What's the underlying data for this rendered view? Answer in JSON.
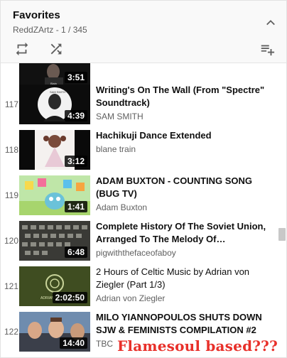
{
  "playlist": {
    "title": "Favorites",
    "owner": "ReddZArtz",
    "separator": " - ",
    "position": "1 / 345"
  },
  "icons": {
    "collapse": "chevron-up-icon",
    "loop": "repeat-icon",
    "shuffle": "shuffle-icon",
    "save": "playlist-add-icon"
  },
  "items": [
    {
      "index": "",
      "title": "",
      "channel": "",
      "duration": "3:51"
    },
    {
      "index": "117",
      "title": "Writing's On The Wall (From \"Spectre\" Soundtrack)",
      "channel": "SAM SMITH",
      "duration": "4:39"
    },
    {
      "index": "118",
      "title": "Hachikuji Dance Extended",
      "channel": "blane train",
      "duration": "3:12"
    },
    {
      "index": "119",
      "title": "ADAM BUXTON - COUNTING SONG (BUG TV)",
      "channel": "Adam Buxton",
      "duration": "1:41"
    },
    {
      "index": "120",
      "title": "Complete History Of The Soviet Union, Arranged To The Melody Of…",
      "channel": "pigwiththefaceofaboy",
      "duration": "6:48"
    },
    {
      "index": "121",
      "title": "2 Hours of Celtic Music by Adrian von Ziegler (Part 1/3)",
      "channel": "Adrian von Ziegler",
      "duration": "2:02:50"
    },
    {
      "index": "122",
      "title": "MILO YIANNOPOULOS SHUTS DOWN SJW & FEMINISTS COMPILATION #2",
      "channel": "TBC",
      "duration": "14:40"
    }
  ],
  "overlay_text": "Flamesoul based???",
  "colors": {
    "header_bg": "#f9f9f9",
    "secondary_text": "#606060",
    "overlay_text": "#e8302a"
  }
}
